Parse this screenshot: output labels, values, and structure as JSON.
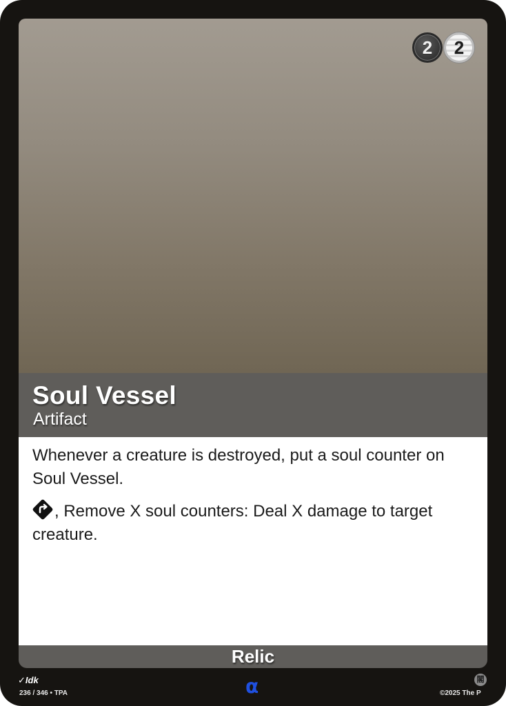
{
  "card": {
    "name": "Soul Vessel",
    "type_line": "Artifact",
    "cost": [
      {
        "value": "2",
        "style": "dark",
        "color": "#3a3a3a"
      },
      {
        "value": "2",
        "style": "light",
        "color": "#f0f0f0"
      }
    ],
    "rules": [
      {
        "icon": null,
        "text": "Whenever a creature is destroyed, put a soul counter on Soul Vessel."
      },
      {
        "icon": "tap-icon",
        "text": ", Remove X soul counters: Deal X damage to target creature."
      }
    ],
    "rarity": "Relic",
    "colors": {
      "frame": "#161411",
      "bar": "#5f5d5a",
      "set_symbol": "#1f50e0"
    }
  },
  "footer": {
    "artist": "Idk",
    "collector_number": "236 / 346 • TPA",
    "set_symbol": "α",
    "badge": "閣",
    "copyright": "©2025 The P"
  }
}
